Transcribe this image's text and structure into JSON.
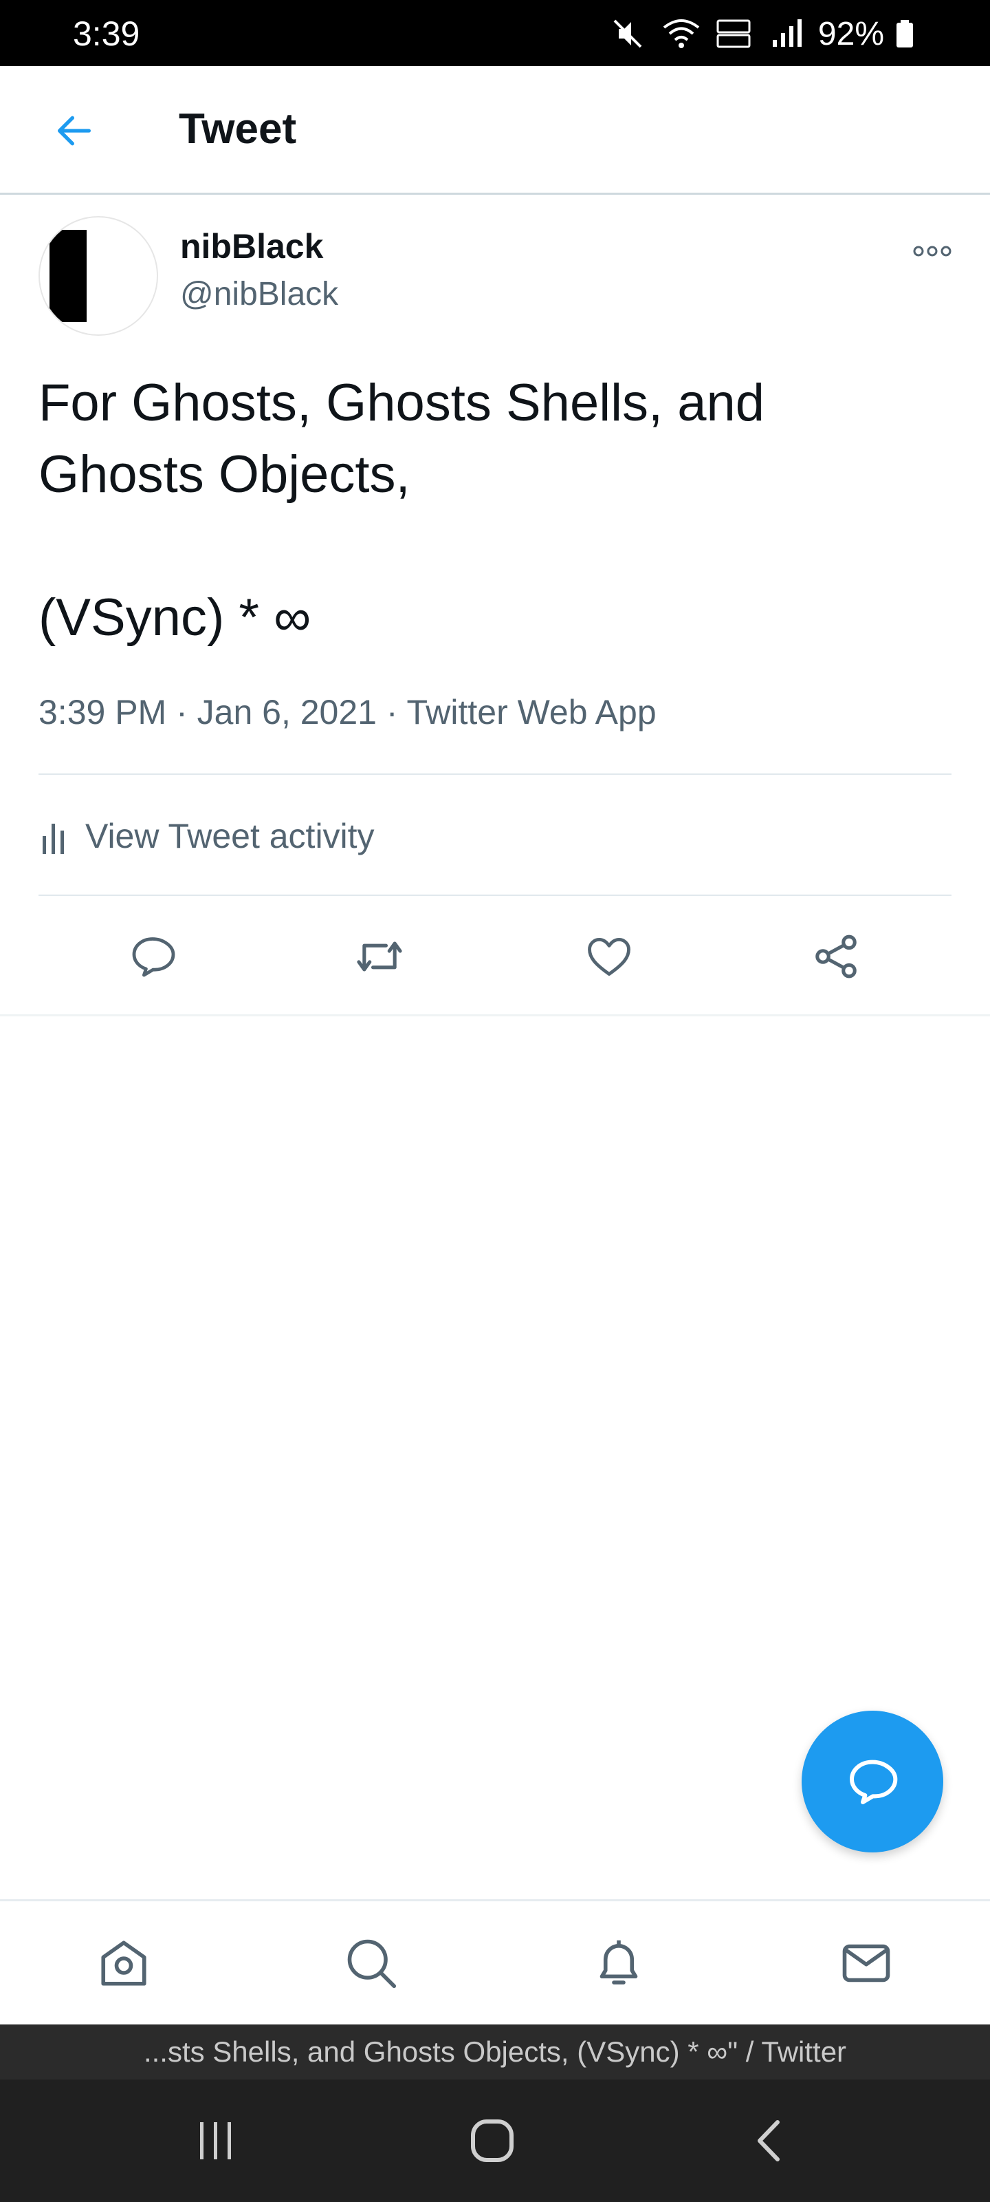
{
  "status_bar": {
    "time": "3:39",
    "battery": "92%"
  },
  "header": {
    "title": "Tweet"
  },
  "tweet": {
    "author_name": "nibBlack",
    "author_handle": "@nibBlack",
    "text": "For Ghosts, Ghosts Shells, and\nGhosts Objects,\n\n(VSync) * ∞",
    "meta": "3:39 PM · Jan 6, 2021  ·  Twitter Web App",
    "activity_label": "View Tweet activity"
  },
  "page_title": "...sts Shells, and Ghosts Objects, (VSync) * ∞\" / Twitter",
  "colors": {
    "accent": "#1d9bf0",
    "secondary_text": "#536471",
    "primary_text": "#0f1419"
  },
  "icons": {
    "back": "arrow-left-icon",
    "more": "more-icon",
    "activity": "bar-chart-icon",
    "reply": "reply-icon",
    "retweet": "retweet-icon",
    "like": "heart-icon",
    "share": "share-icon",
    "compose": "compose-reply-icon",
    "home": "home-icon",
    "search": "search-icon",
    "notifications": "bell-icon",
    "messages": "mail-icon"
  }
}
